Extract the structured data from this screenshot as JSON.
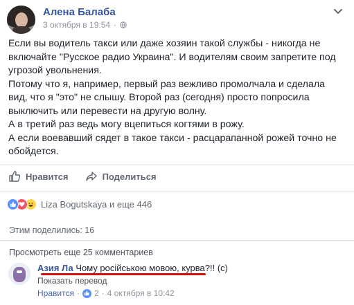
{
  "post": {
    "author": "Алена Балаба",
    "date": "3 октября в 19:54",
    "separator": "·",
    "paragraphs": [
      "Если вы водитель такси или даже хозяин такой службы - никогда не включайте \"Русское радио Украина\". И водителям своим запретите под угрозой увольнения.",
      "Потому что я, например, первый раз вежливо промолчала и сделала вид, что я \"это\" не слышу. Второй раз (сегодня) просто попросила выключить или перевести на другую волну.",
      "А в третий раз ведь могу вцепиться когтями в рожу.",
      "А если воевавший сядет в такое такси - расцарапанной рожей точно не обойдется."
    ]
  },
  "actions": {
    "like": "Нравится",
    "share": "Поделиться"
  },
  "reactions": {
    "names": "Liza Bogutskaya и еще 446"
  },
  "shares": "Этим поделились: 16",
  "more_comments": "Просмотреть еще 25 комментариев",
  "comment": {
    "author": "Азия Ла",
    "text": "Чому російською мовою, курва?!! (с)",
    "translate": "Показать перевод",
    "like": "Нравится",
    "dot": "·",
    "likes": "2",
    "date": "4 октября в 10:42"
  },
  "icons": {
    "globe": "globe-icon",
    "chevron": "chevron-down-icon",
    "like": "thumbs-up-icon",
    "share": "share-arrow-icon"
  },
  "colors": {
    "link": "#365899",
    "accent": "#5890ff",
    "underline": "#d60f0f"
  }
}
